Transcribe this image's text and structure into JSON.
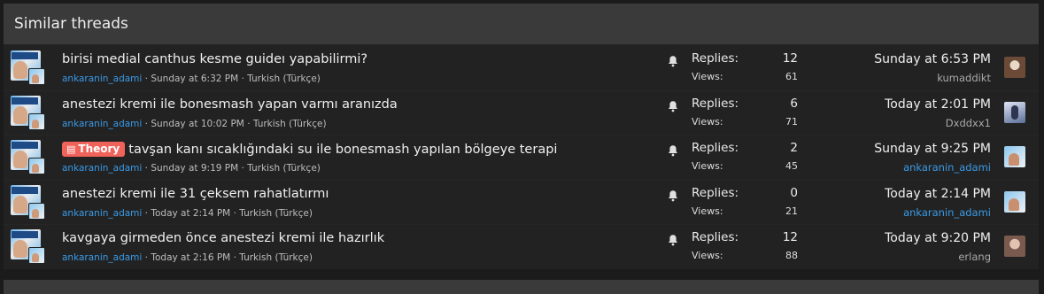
{
  "header": {
    "title": "Similar threads"
  },
  "colors": {
    "accent_link": "#3a9ae6",
    "prefix_theory": "#f0635a",
    "header_bg": "#3a3a3a"
  },
  "threads": [
    {
      "title": "birisi medial canthus kesme guideı yapabilirmi?",
      "prefix": "",
      "author": "ankaranin_adami",
      "date": "Sunday at 6:32 PM",
      "forum": "Turkish (Türkçe)",
      "replies_label": "Replies:",
      "replies": "12",
      "views_label": "Views:",
      "views": "61",
      "last_date": "Sunday at 6:53 PM",
      "last_user": "kumaddikt",
      "last_user_is_link": false,
      "avatar_icon": "brown-portrait-avatar"
    },
    {
      "title": "anestezi kremi ile bonesmash yapan varmı aranızda",
      "prefix": "",
      "author": "ankaranin_adami",
      "date": "Sunday at 10:02 PM",
      "forum": "Turkish (Türkçe)",
      "replies_label": "Replies:",
      "replies": "6",
      "views_label": "Views:",
      "views": "71",
      "last_date": "Today at 2:01 PM",
      "last_user": "Dxddxx1",
      "last_user_is_link": false,
      "avatar_icon": "dark-figure-avatar"
    },
    {
      "title": "tavşan kanı sıcaklığındaki su ile bonesmash yapılan bölgeye terapi",
      "prefix": "Theory",
      "author": "ankaranin_adami",
      "date": "Sunday at 9:19 PM",
      "forum": "Turkish (Türkçe)",
      "replies_label": "Replies:",
      "replies": "2",
      "views_label": "Views:",
      "views": "45",
      "last_date": "Sunday at 9:25 PM",
      "last_user": "ankaranin_adami",
      "last_user_is_link": true,
      "avatar_icon": "meme-avatar"
    },
    {
      "title": "anestezi kremi ile 31 çeksem rahatlatırmı",
      "prefix": "",
      "author": "ankaranin_adami",
      "date": "Today at 2:14 PM",
      "forum": "Turkish (Türkçe)",
      "replies_label": "Replies:",
      "replies": "0",
      "views_label": "Views:",
      "views": "21",
      "last_date": "Today at 2:14 PM",
      "last_user": "ankaranin_adami",
      "last_user_is_link": true,
      "avatar_icon": "meme-avatar"
    },
    {
      "title": "kavgaya girmeden önce anestezi kremi ile hazırlık",
      "prefix": "",
      "author": "ankaranin_adami",
      "date": "Today at 2:16 PM",
      "forum": "Turkish (Türkçe)",
      "replies_label": "Replies:",
      "replies": "12",
      "views_label": "Views:",
      "views": "88",
      "last_date": "Today at 9:20 PM",
      "last_user": "erlang",
      "last_user_is_link": false,
      "avatar_icon": "girl-portrait-avatar"
    }
  ],
  "separator": " · "
}
